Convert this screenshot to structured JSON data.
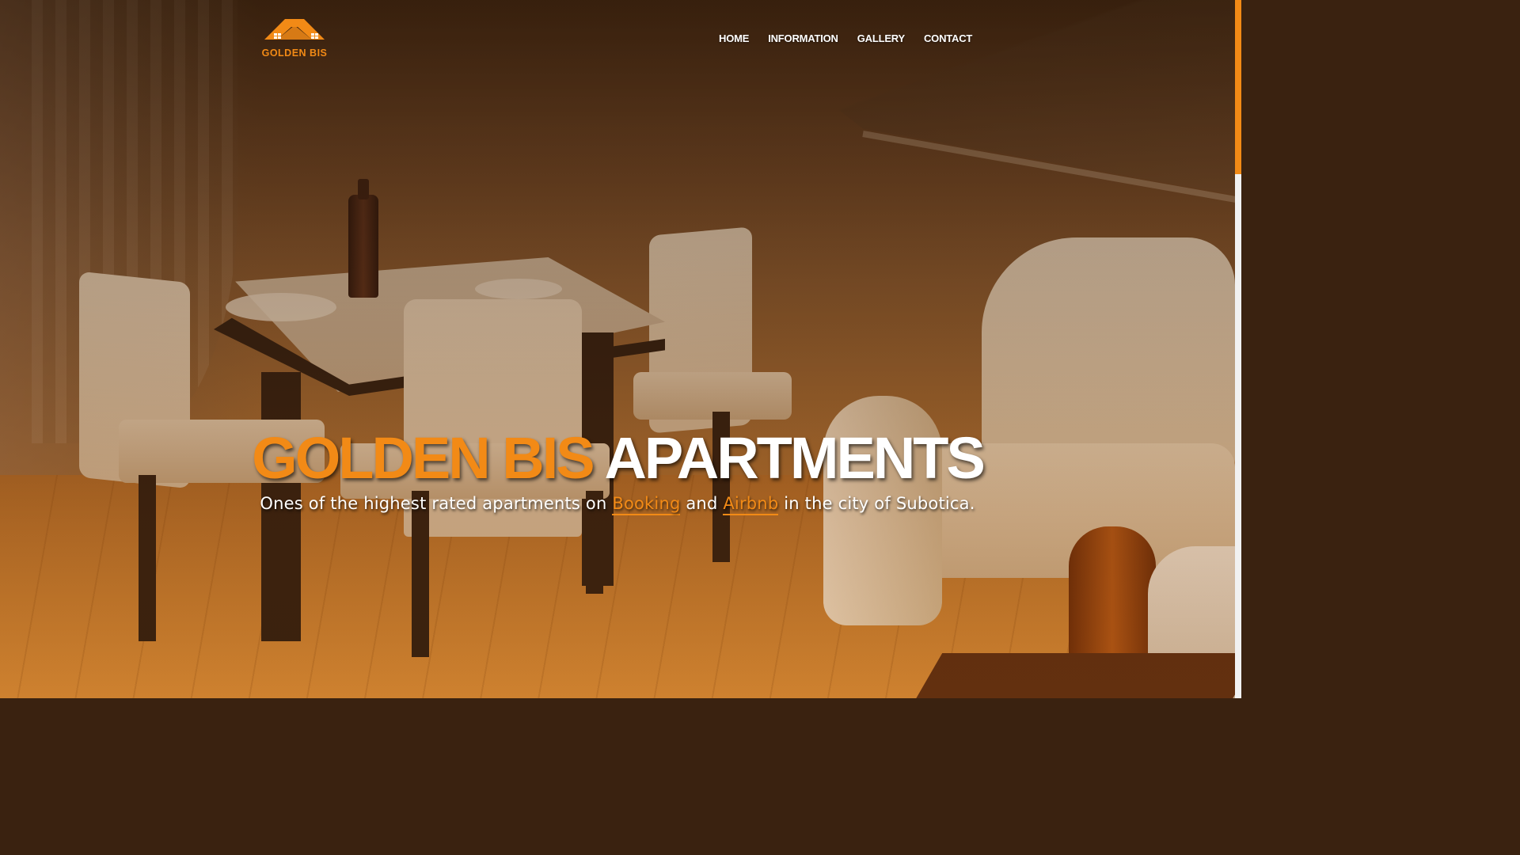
{
  "brand": {
    "name": "GOLDEN BIS",
    "accent_color": "#f28a16",
    "logo_icon": "house-roof-icon"
  },
  "nav": {
    "items": [
      {
        "label": "HOME"
      },
      {
        "label": "INFORMATION"
      },
      {
        "label": "GALLERY"
      },
      {
        "label": "CONTACT"
      }
    ]
  },
  "hero": {
    "title_accent": "GOLDEN BIS",
    "title_plain": "APARTMENTS",
    "subtitle_before": "Ones of the highest rated apartments on ",
    "link_booking": "Booking",
    "subtitle_and": " and ",
    "link_airbnb": "Airbnb",
    "subtitle_after": " in the city of Subotica.",
    "background_image": "dining-room-photo"
  },
  "scrollbar": {
    "thumb_color": "#f28a16"
  }
}
